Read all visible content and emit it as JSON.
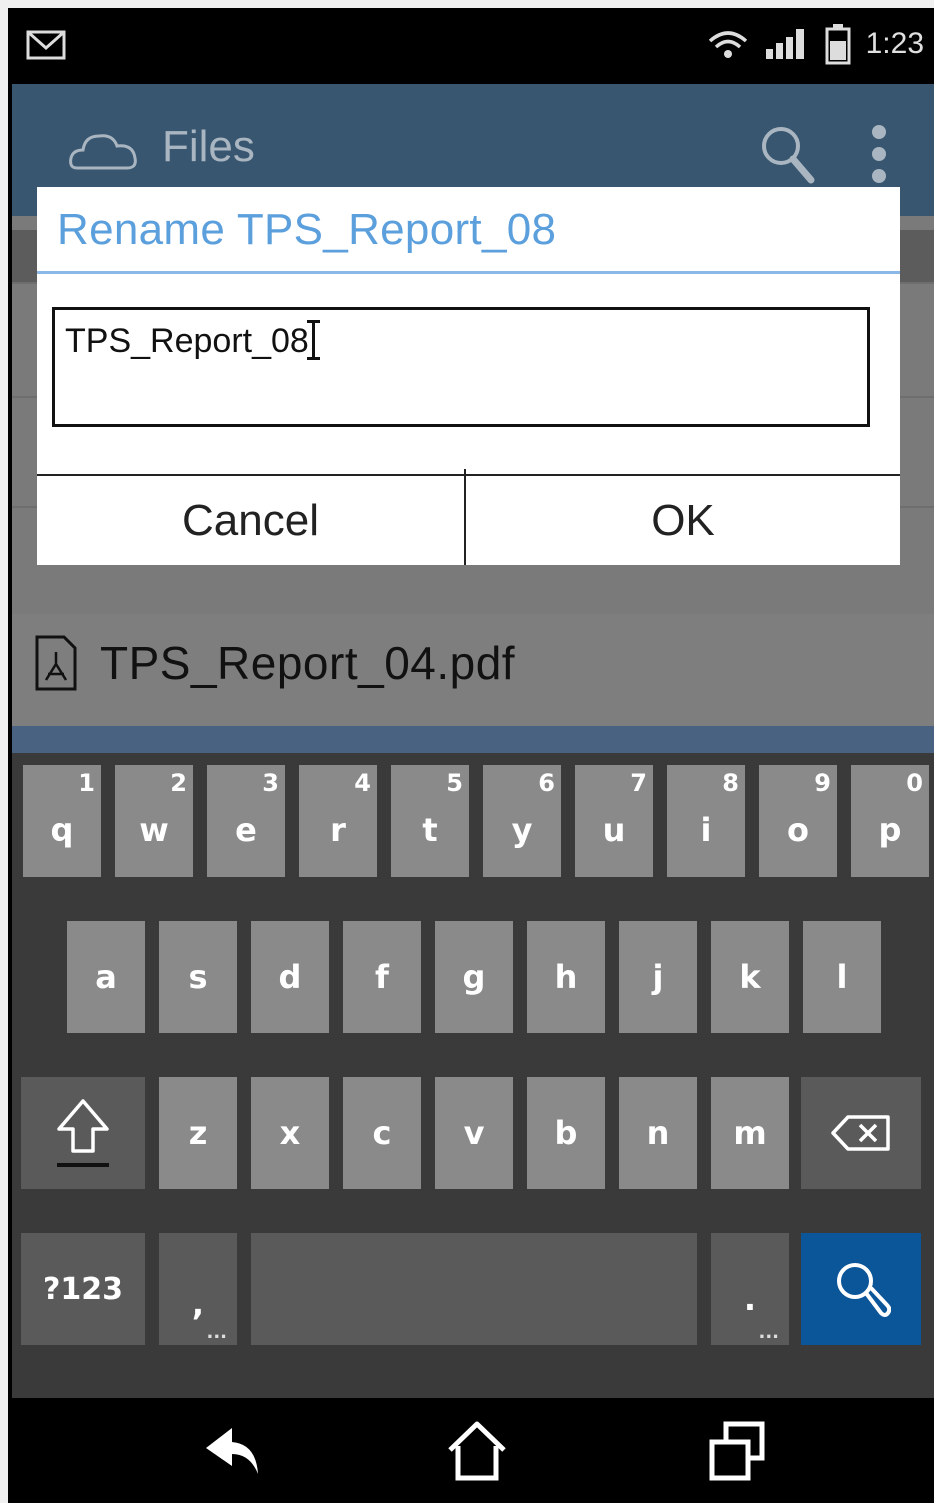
{
  "status_bar": {
    "time": "1:23"
  },
  "app_bar": {
    "title": "Files"
  },
  "file_list": {
    "visible_file": "TPS_Report_04.pdf"
  },
  "dialog": {
    "title": "Rename TPS_Report_08",
    "input_value": "TPS_Report_08",
    "cancel_label": "Cancel",
    "ok_label": "OK"
  },
  "keyboard": {
    "row1": [
      {
        "key": "q",
        "num": "1"
      },
      {
        "key": "w",
        "num": "2"
      },
      {
        "key": "e",
        "num": "3"
      },
      {
        "key": "r",
        "num": "4"
      },
      {
        "key": "t",
        "num": "5"
      },
      {
        "key": "y",
        "num": "6"
      },
      {
        "key": "u",
        "num": "7"
      },
      {
        "key": "i",
        "num": "8"
      },
      {
        "key": "o",
        "num": "9"
      },
      {
        "key": "p",
        "num": "0"
      }
    ],
    "row2": [
      "a",
      "s",
      "d",
      "f",
      "g",
      "h",
      "j",
      "k",
      "l"
    ],
    "row3": [
      "z",
      "x",
      "c",
      "v",
      "b",
      "n",
      "m"
    ],
    "symbols_label": "?123",
    "comma": ",",
    "period": ".",
    "more_marker": "..."
  }
}
